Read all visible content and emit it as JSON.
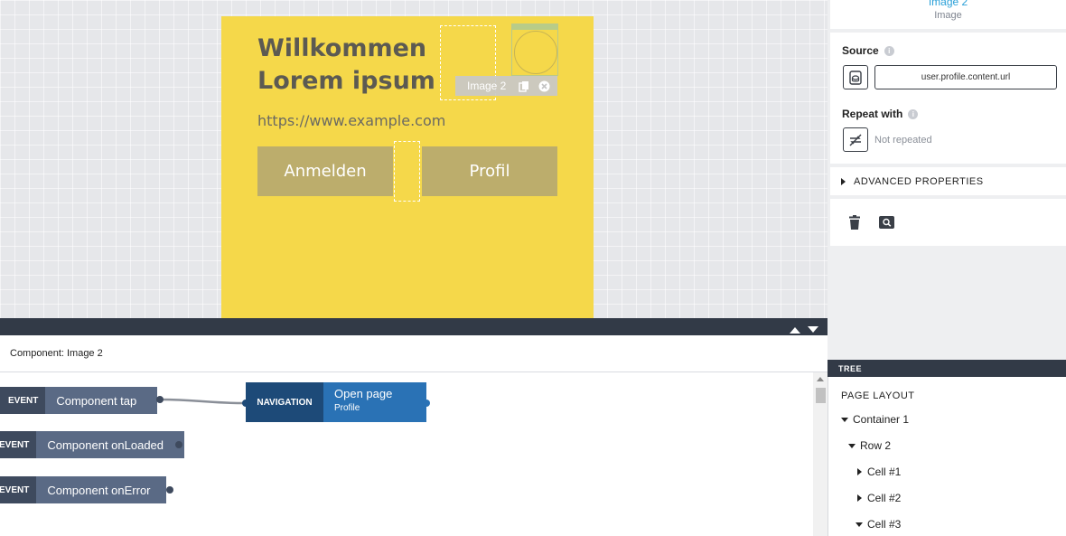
{
  "app_page": {
    "title_line1": "Willkommen",
    "title_line2": "Lorem ipsum",
    "url": "https://www.example.com",
    "button_anmelden": "Anmelden",
    "button_profil": "Profil",
    "selected_label": "Image 2",
    "background_color": "#f5d84a"
  },
  "logic_editor": {
    "component_label": "Component: Image 2",
    "nodes": [
      {
        "tag": "EVENT",
        "label": "Component tap"
      },
      {
        "tag": "EVENT",
        "label": "Component onLoaded"
      },
      {
        "tag": "EVENT",
        "label": "Component onError"
      }
    ],
    "navigation": {
      "tag": "NAVIGATION",
      "title": "Open page",
      "subtitle": "Profile"
    }
  },
  "properties": {
    "component_name": "Image 2",
    "component_type": "Image",
    "source_label": "Source",
    "source_value": "user.profile.content.url",
    "repeat_label": "Repeat with",
    "repeat_value": "Not repeated",
    "advanced_label": "ADVANCED PROPERTIES"
  },
  "tree": {
    "header": "TREE",
    "title": "PAGE LAYOUT",
    "items": [
      {
        "label": "Container 1",
        "expanded": true
      },
      {
        "label": "Row 2",
        "expanded": true
      },
      {
        "label": "Cell #1",
        "expanded": false
      },
      {
        "label": "Cell #2",
        "expanded": false
      },
      {
        "label": "Cell #3",
        "expanded": true
      }
    ]
  },
  "colors": {
    "accent_blue": "#2aa0d8",
    "dark_bar": "#323a47",
    "navigation_node": "#2a72b5",
    "event_node": "#5a6a85"
  }
}
